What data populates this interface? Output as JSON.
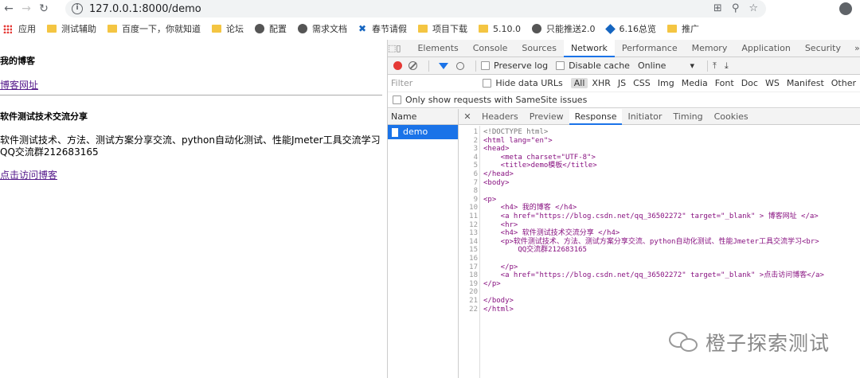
{
  "browser": {
    "url": "127.0.0.1:8000/demo",
    "bookmarks": [
      {
        "label": "应用",
        "icon": "apps-grid-icon"
      },
      {
        "label": "测试辅助",
        "icon": "folder-icon"
      },
      {
        "label": "百度一下，你就知道",
        "icon": "folder-icon"
      },
      {
        "label": "论坛",
        "icon": "folder-icon"
      },
      {
        "label": "配置",
        "icon": "globe-icon"
      },
      {
        "label": "需求文档",
        "icon": "globe-icon"
      },
      {
        "label": "春节请假",
        "icon": "bolt-icon"
      },
      {
        "label": "项目下载",
        "icon": "folder-icon"
      },
      {
        "label": "5.10.0",
        "icon": "folder-icon"
      },
      {
        "label": "只能推送2.0",
        "icon": "globe-icon"
      },
      {
        "label": "6.16总览",
        "icon": "diamond-icon"
      },
      {
        "label": "推广",
        "icon": "folder-icon"
      }
    ]
  },
  "page": {
    "heading1": "我的博客",
    "link1": "博客网址",
    "heading2": "软件测试技术交流分享",
    "para_line1": "软件测试技术、方法、测试方案分享交流、python自动化测试、性能Jmeter工具交流学习",
    "para_line2": "QQ交流群212683165",
    "link2": "点击访问博客"
  },
  "devtools": {
    "tabs": [
      "Elements",
      "Console",
      "Sources",
      "Network",
      "Performance",
      "Memory",
      "Application",
      "Security"
    ],
    "active_tab": "Network",
    "toolbar": {
      "preserve_log": "Preserve log",
      "disable_cache": "Disable cache",
      "throttle": "Online"
    },
    "filter_placeholder": "Filter",
    "hide_data_urls": "Hide data URLs",
    "types": [
      "All",
      "XHR",
      "JS",
      "CSS",
      "Img",
      "Media",
      "Font",
      "Doc",
      "WS",
      "Manifest",
      "Other"
    ],
    "samesite": "Only show requests with SameSite issues",
    "name_header": "Name",
    "request": "demo",
    "detail_tabs": [
      "Headers",
      "Preview",
      "Response",
      "Initiator",
      "Timing",
      "Cookies"
    ],
    "active_detail": "Response",
    "source_lines": [
      "<!DOCTYPE html>",
      "<html lang=\"en\">",
      "<head>",
      "    <meta charset=\"UTF-8\">",
      "    <title>demo模板</title>",
      "</head>",
      "<body>",
      "",
      "<p>",
      "    <h4> 我的博客 </h4>",
      "    <a href=\"https://blog.csdn.net/qq_36502272\" target=\"_blank\" > 博客网址 </a>",
      "    <hr>",
      "    <h4> 软件测试技术交流分享 </h4>",
      "    <p>软件测试技术、方法、测试方案分享交流、python自动化测试、性能Jmeter工具交流学习<br>",
      "        QQ交流群212683165",
      "",
      "    </p>",
      "    <a href=\"https://blog.csdn.net/qq_36502272\" target=\"_blank\" >点击访问博客</a>",
      "</p>",
      "",
      "</body>",
      "</html>"
    ]
  },
  "watermark": "橙子探索测试"
}
